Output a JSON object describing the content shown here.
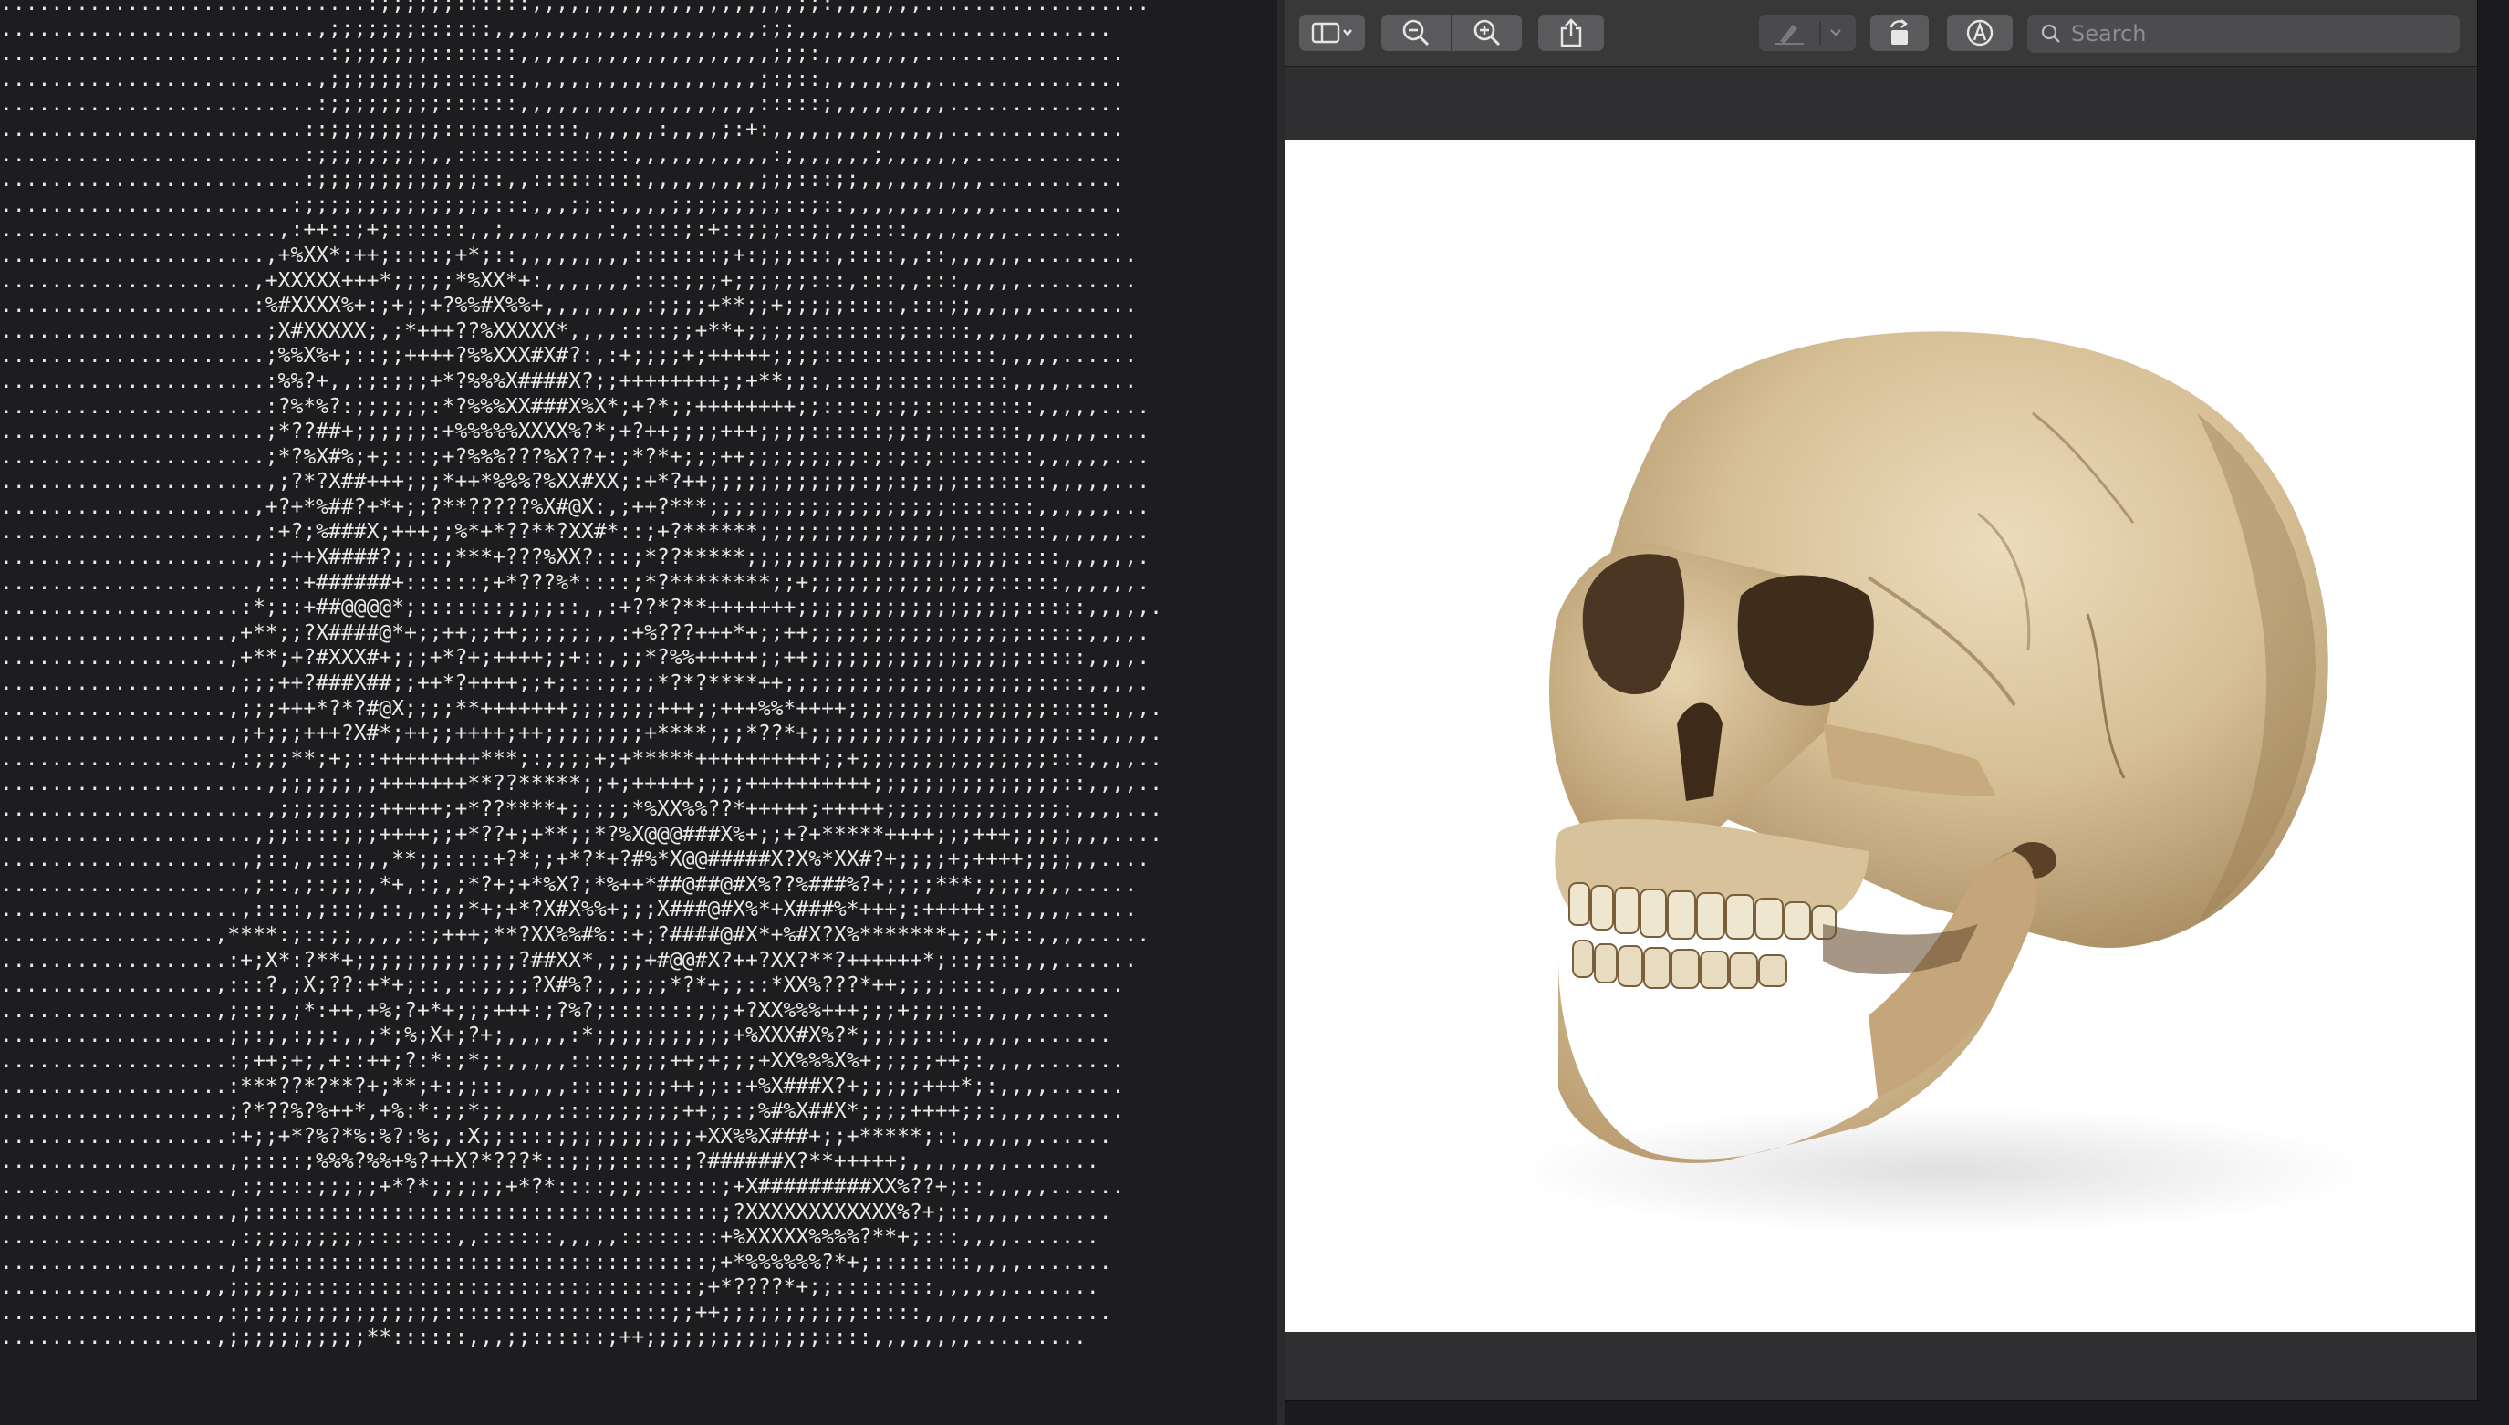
{
  "terminal": {
    "ascii_art": ".............................:;;;;;;::::::,,,,,,,,,,,,,,,,,,,,,;;:,,,,,,,..................\n.........................,;;;;;;;::::::,,,,,,,,,,,,,,,,,,,,,:;;,,,,,,,,.................\n..........................:;;;;;;;:::::::,,,,,,,,,,,,,,,,,,,,;;;:,,,,,,,,................\n.........................,;;;;;;;;;::::::,,,,,,,,,,,,,,,,,,,;:;::,,,,,,,,,...............\n.........................:;;;;;;;;;::::::,,,,,,,,,,,,,,,,,,,:::::;,,,,,,,,,..............\n........................::;;;;;;;;;:::::::::::,,,,,,:,,,,;:+:,,,,,,,,,,,,,,..............\n........................:;;;;;;;;;,,::::::::::::::,,,,,,,,,,,:;,,,,,,;,,,,,,,............\n........................:;;;;;;;;;;;;;::,,:::::::::,,,,,,,,,;;;:::;;,,,,,,,,,,...........\n.......................:;;;;;;;;;;;;;;;:::,,,;;::,,,,;;;;;;;;;::;::,,,,,,,,,,,,..........\n......................,:++::;+;::::::,,;,,,,,,,,:,::::;:+::;;;::;;,;::::,,,,,,,,.........\n.....................,+%XX*:++;::::;+*;::,,,,,,,,,:::::::;+:;;;:::,::::,,::,,,,,,.........\n....................,+XXXXX+++*;;;;;*%XX*+:,,,,,,,::::;;;+;;;;;;:::,:::,,:::,,,,,.........\n....................:%#XXXX%+:;+;;+?%%#X%%+,,,,,,,,:;;;;+**;;+;;;;;::::,:::;;,,,,,........\n.....................;X#XXXXX;,;*+++??%XXXXX*,,,,::::;;+**+;;;;;:::::::;:::::,,,,,,.......\n.....................;%%X%+;::;;++++?%%XXX#X#?:,:+;;;;+;+++++;;;;::::::::::::::,,,,,......\n.....................:%%?+,,:;:;;;+*?%%%X####X?;;++++++++;;+**;;:,:::;::::::::::,,,,,.....\n.....................:?%*%?:;;;;;;:*?%%%XX###X%X*;+?*;;++++++++;;::::;:;;:::::::::,,,,,....\n.....................;*??##+;;;;;;:+%%%%%XXXX%?*;+?++;;;;+++;;;;::::::;;:;:::::::,,,,,,....\n.....................;*?%X#%;+;:::;+?%%%???%X??+:;*?*+;;;++;;;;;;;;;:;:;:;::::::::,,,,,,...\n.....................,;?*?X##+++;;;*++*%%%?%XX#XX;:+*?++;;;;;;;;;;;;:;;:;:;;:::::::,,,,,...\n....................,+?+*%##?+*+;;?**?????%X#@X:,;++?***;;;;;;;;;;;;;;;;;;;:::::::,,,,,,...\n....................,:+?;%###X;+++;;%*+*??**?XX#*::;+?******;;;;;;;;;;;;;;;;:::::::,,,,,,..\n....................,:;++X####?;;::;***+???%XX?:::;*??*****;;;;;;;;;;;;;;;;;;;;;::::,,,,,,.\n....................,:::+######+::::::;+*???%*::::;*?********;;+;;;;;;;;;;;;;;;:::::,,,,,,.\n...................:*;::+##@@@@*;:::::::;;;;::,,:+??*?**+++++++;;;;;;;;;;;;;;;;;;:::::,,,,,.\n..................,+**;;?X####@*+;;++;;++;;;;;;,,:+%???+++*+;;++;;;;;;;;;;;;;;;;;:::::,,,,.\n..................,+**;+?#XXX#+;;;+*?+;++++;;+::,;;*?%%+++++;;++;;;;;;;;;;;;;;;;;:::::,,,,.\n..................,;;;++?###X##;;++*?++++;;+;:::;;;;*?*?****++;;;;;;;;;;;;;;;;;;;;::::,,,,.\n..................,;;;+++*?*?#@X;;;;**+++++++;;;;;;;+++;;+++%%*++++;;;;;;;;;;;;;;;;:::::,,,.\n..................,;+;;;+++?X#*;++;;++++;++;;;;;;;;+****;;;*??*+;;;;;;;;;;;;;;;;;;;;:::,,,,.\n..................,:;;;**;+;::++++++++***;:;;;;+;+*****++++++++++;;+;;;;;;;;;;;;;;;:::,,,,..\n.....................,;;;;;;,;+++++++**??*****;;+;+++++;;;;++++++++++;;;;;;;;;;;;;;;::,,,,..\n.....................,;;;;;;;;+++++;+*??****+;;;;;*%XX%%??*+++++;+++++;;;;;;;;;;;;;;:,,,,...\n....................,;;::::;;;++++;;+*??+;+**;;*?%X@@@###X%+;;+?+*****++++;;;+++;;;;;,,,....\n...................,;::,,:::;,,**;;::::+?*;;+*?*+?#%*X@@#####X?X%*XX#?+;;;;+;++++;;;;,,....\n...................,;::,;:;;;,*+,:;,;*?+;+*%X?;*%++*##@##@#X%??%###%?+;;;;***;;;;;;,,.....\n...................,::::,;::;,::,,:;;*+;+*?X#X%%+;;;X###@#X%*+X###%*+++;:+++++:::,,,,.....\n.................,****:;::;;,,,,::;+++;**?XX%%#%::+;?####@#X*+%#X?X%*******+;;+;::,,,,.....\n..................:+;X*:?**+;;;;;;;;;:;;;?##XX*,;;;+#@@#X?++?XX?**?++++++*;::;:::,,,......\n.................,:::?,;X;??:+*+;::,::;;;;?X#%?;,;;;;*?*+;;::*XX%???*++;;;;::::,,,,......\n.................,;::;,;*:++,+%;?+*+;;;+++:;?%?;:::::::;;;+?XX%%%+++;;;+;;;:::,,,,......\n..................;;:;,:;;:,,;*;%;X+;?+;,,,,,:*;;;;;;;;;;;+%XXX#X%?*;;;;;:::,,,,,.......\n..................:;++;+;,+::++;?:*:;*;:,,,,,::::;;;;++;+;;;+XX%%%X%+;;;;;++;:,,,,.......\n..................:***??*?**?+;**;+:;;::,,,,,::::;;;;++;;::+%X###X?+;;;;;+++*;:,,,,......\n..................;?*??%?%++*,+%:*:;;*;;,,,,::::;;;;;;++;;:;%#%X##X*;;;;++++;;:,,,,......\n..................:+;;+*?%?*%:%?:%;,:X;;::::;;;;;;;;;;;+XX%%X###+;;+*****;::,,,,,,......\n..................,;::::;%%%?%%+%?++X?*???*::;;;;:::::;?######X?**+++++;,,,,,,,,.......\n..................,:;::::;;;;;+*?*;;;;;;+*?*::::;;;::::::;+X#########XX%??+;::,,,,,......\n..................,;:::::::::::::::::::::::::::::::::::::;?XXXXXXXXXXXX%?+;::,,,,.......\n..................,:;;;;;;;;;:::::::,,::::::,,,,,::::::::+%XXXXX%%%%?**+;:::,,,,.......\n..................,:;:::::::::::::::::::::::::::::::::::;+*%%%%%%?*+;::::::::,,,,.......\n................,,;;;;;;:::::::::::::::::::::::::::::::;+*????*+;;::::::::,,,,,,.......\n.................,:;:;;;;;;;;;;;;;;::::::::::::::::::;;++;;;;;;;;;;;:::::,,,,,,,........\n.................,;;;;;;;;;;;**::::::,,,;;::::::;++;;;;;;;;;;;;;;::::,,,,,,,,........."
  },
  "preview": {
    "search_placeholder": "Search",
    "colors": {
      "toolbar_bg": "#383839",
      "button_bg": "#5a5a5c",
      "search_bg": "#4c4c4e",
      "window_bg": "#2f2f31",
      "canvas_bg": "#ffffff",
      "bone": "#d9c49d"
    },
    "icons": [
      "sidebar-toggle-icon",
      "chevron-down-icon",
      "zoom-out-icon",
      "zoom-in-icon",
      "share-icon",
      "markup-pen-icon",
      "rotate-icon",
      "annotate-icon",
      "search-icon"
    ]
  }
}
